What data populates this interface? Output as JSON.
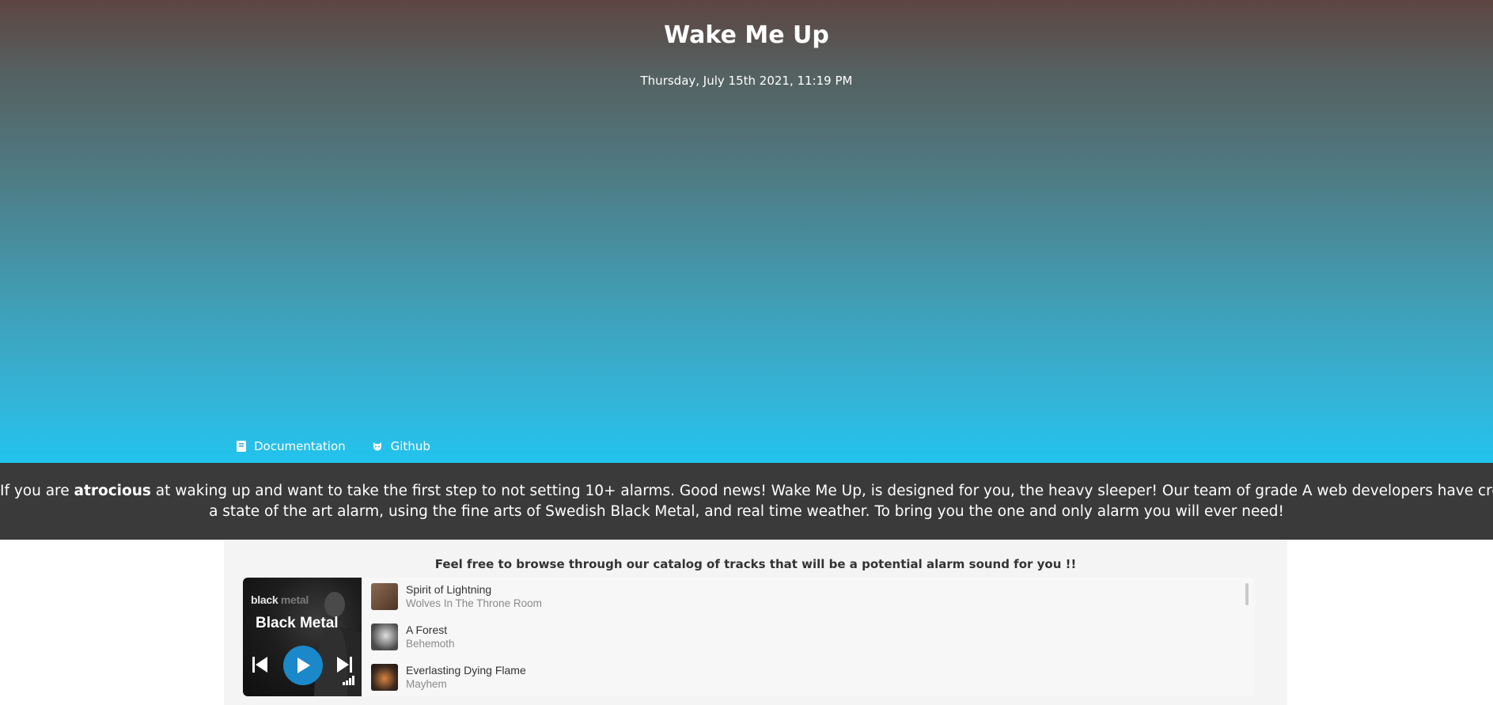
{
  "hero": {
    "title": "Wake Me Up",
    "date": "Thursday, July 15th 2021, 11:19 PM",
    "links": [
      {
        "label": "Documentation",
        "icon": "book-icon"
      },
      {
        "label": "Github",
        "icon": "github-icon"
      }
    ]
  },
  "banner": {
    "line1_before": "If you are ",
    "line1_bold": "atrocious",
    "line1_after": " at waking up and want to take the first step to not setting 10+ alarms. Good news! Wake Me Up, is designed for you, the heavy sleeper! Our team of grade A web developers have created",
    "line2": "a state of the art alarm, using the fine arts of Swedish Black Metal, and real time weather. To bring you the one and only alarm you will ever need!"
  },
  "catalog": {
    "heading": "Feel free to browse through our catalog of tracks that will be a potential alarm sound for you !!",
    "player": {
      "cover_small_prefix": "black",
      "cover_small_suffix": "metal",
      "playlist_title": "Black Metal",
      "controls": [
        "previous-icon",
        "play-icon",
        "next-icon"
      ],
      "tracks": [
        {
          "title": "Spirit of Lightning",
          "artist": "Wolves In The Throne Room",
          "thumb_color": "#6b4a36"
        },
        {
          "title": "A Forest",
          "artist": "Behemoth",
          "thumb_color": "#9a9a9a"
        },
        {
          "title": "Everlasting Dying Flame",
          "artist": "Mayhem",
          "thumb_color": "#3d2a20"
        }
      ]
    }
  },
  "colors": {
    "banner_bg": "#3a3a3a",
    "play_button": "#1a88c9",
    "hero_top": "#5d4541",
    "hero_bottom": "#22c3ee"
  }
}
